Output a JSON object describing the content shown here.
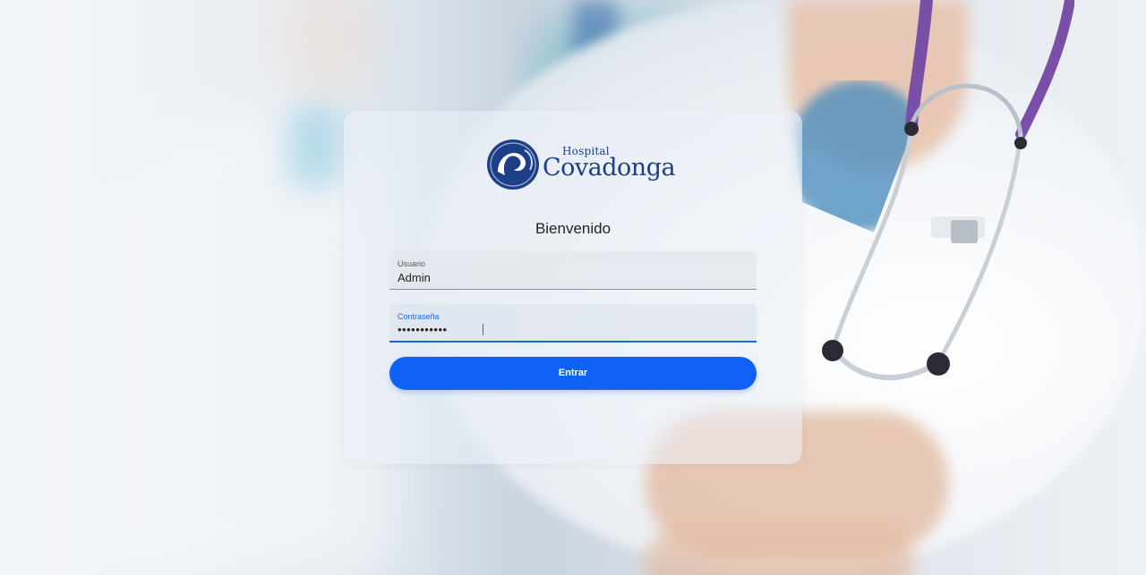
{
  "logo": {
    "line1": "Hospital",
    "line2": "Covadonga"
  },
  "login": {
    "title": "Bienvenido",
    "username": {
      "label": "Usuario",
      "value": "Admin"
    },
    "password": {
      "label": "Contraseña",
      "value": "•••••••••••"
    },
    "submit_label": "Entrar"
  },
  "colors": {
    "primary": "#0f62f5",
    "logo": "#1e3f86",
    "focus_underline": "#1f66e0"
  },
  "icons": {
    "logo_mark": "hospital-covadonga-swirl"
  }
}
